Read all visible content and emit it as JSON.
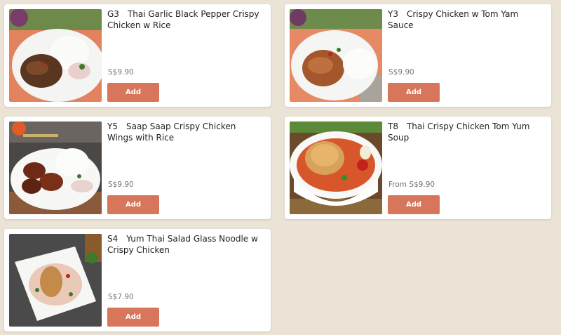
{
  "menu_items": [
    {
      "code": "G3",
      "name": "Thai Garlic Black Pepper Crispy Chicken w Rice",
      "price": "S$9.90",
      "add_label": "Add"
    },
    {
      "code": "Y3",
      "name": "Crispy Chicken w Tom Yam Sauce",
      "price": "S$9.90",
      "add_label": "Add"
    },
    {
      "code": "Y5",
      "name": "Saap Saap Crispy Chicken Wings with Rice",
      "price": "S$9.90",
      "add_label": "Add"
    },
    {
      "code": "T8",
      "name": "Thai Crispy Chicken Tom Yum Soup",
      "price": "From S$9.90",
      "add_label": "Add"
    },
    {
      "code": "S4",
      "name": "Yum Thai Salad Glass Noodle w Crispy Chicken",
      "price": "S$7.90",
      "add_label": "Add"
    }
  ],
  "colors": {
    "page_background": "#ece3d7",
    "card_background": "#ffffff",
    "add_button": "#d7765a"
  }
}
